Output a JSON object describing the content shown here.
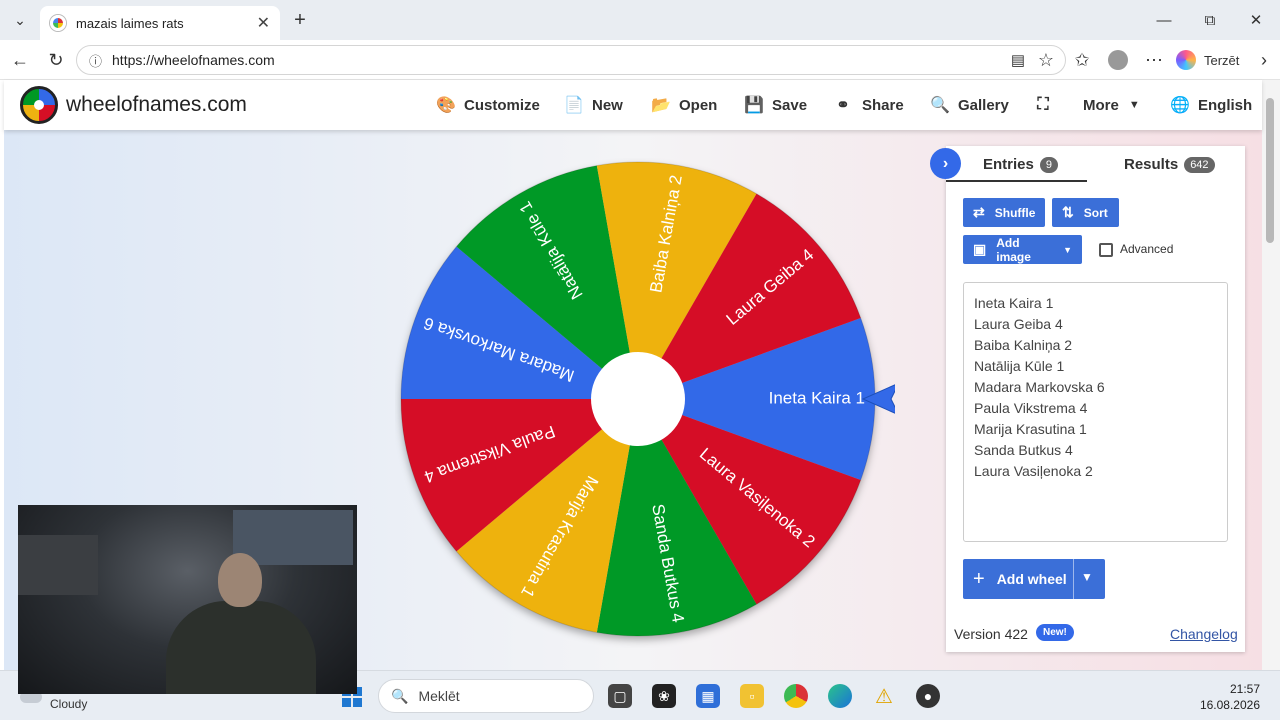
{
  "browser": {
    "tab_title": "mazais laimes rats",
    "url": "https://wheelofnames.com",
    "copilot_label": "Terzēt"
  },
  "site": {
    "name": "wheelofnames.com",
    "nav": {
      "customize": "Customize",
      "new": "New",
      "open": "Open",
      "save": "Save",
      "share": "Share",
      "gallery": "Gallery",
      "more": "More",
      "language": "English"
    }
  },
  "wheel": {
    "pointer_color": "#3369e8",
    "segments": [
      {
        "label": "Ineta Kaira 1",
        "color": "#3369e8"
      },
      {
        "label": "Laura Vasiļenoka 2",
        "color": "#d50f25"
      },
      {
        "label": "Sanda Butkus 4",
        "color": "#009925"
      },
      {
        "label": "Marija Krasutina 1",
        "color": "#eeb211"
      },
      {
        "label": "Paula Vikstrema 4",
        "color": "#d50f25"
      },
      {
        "label": "Madara Markovska 6",
        "color": "#3369e8"
      },
      {
        "label": "Natālija Kūle 1",
        "color": "#009925"
      },
      {
        "label": "Baiba Kalniņa 2",
        "color": "#eeb211"
      },
      {
        "label": "Laura Geiba 4",
        "color": "#d50f25"
      }
    ]
  },
  "panel": {
    "entries_tab": "Entries",
    "entries_count": "9",
    "results_tab": "Results",
    "results_count": "642",
    "shuffle": "Shuffle",
    "sort": "Sort",
    "add_image": "Add image",
    "advanced": "Advanced",
    "entries": [
      "Ineta Kaira 1",
      "Laura Geiba 4",
      "Baiba Kalniņa 2",
      "Natālija Kūle 1",
      "Madara Markovska 6",
      "Paula Vikstrema 4",
      "Marija Krasutina 1",
      "Sanda Butkus 4",
      "Laura Vasiļenoka 2"
    ],
    "add_wheel": "Add wheel",
    "version": "Version 422",
    "new_badge": "New!",
    "changelog": "Changelog"
  },
  "taskbar": {
    "weather": "Cloudy",
    "search_placeholder": "Meklēt",
    "time": "21:57",
    "date": "16.08.2026"
  }
}
